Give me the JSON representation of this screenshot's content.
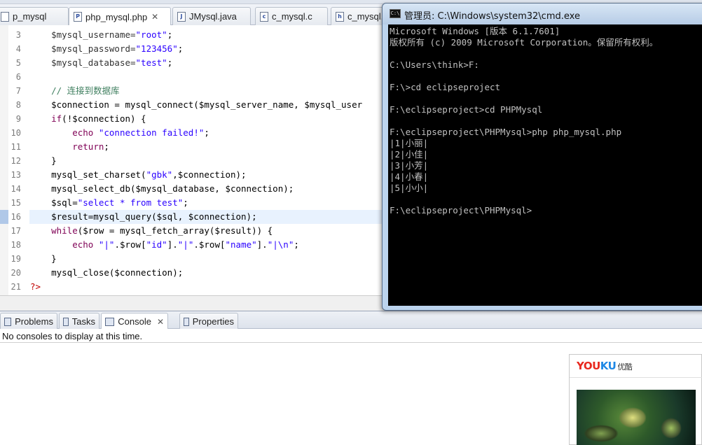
{
  "editor_tabs": [
    {
      "label": "p_mysql",
      "icon": "file-icon"
    },
    {
      "label": "php_mysql.php",
      "icon": "php-file-icon",
      "active": true,
      "closable": true
    },
    {
      "label": "JMysql.java",
      "icon": "java-file-icon"
    },
    {
      "label": "c_mysql.c",
      "icon": "c-file-icon"
    },
    {
      "label": "c_mysql.h",
      "icon": "h-file-icon"
    }
  ],
  "code": {
    "current_line": "16",
    "lines": [
      {
        "n": "3",
        "text": "    $mysql_username=\"root\";"
      },
      {
        "n": "4",
        "text": "    $mysql_password=\"123456\";"
      },
      {
        "n": "5",
        "text": "    $mysql_database=\"test\";"
      },
      {
        "n": "6",
        "text": ""
      },
      {
        "n": "7",
        "text": "    // 连接到数据库"
      },
      {
        "n": "8",
        "text": "    $connection = mysql_connect($mysql_server_name, $mysql_user"
      },
      {
        "n": "9",
        "text": "    if(!$connection) {"
      },
      {
        "n": "10",
        "text": "        echo \"connection failed!\";"
      },
      {
        "n": "11",
        "text": "        return;"
      },
      {
        "n": "12",
        "text": "    }"
      },
      {
        "n": "13",
        "text": "    mysql_set_charset(\"gbk\",$connection);"
      },
      {
        "n": "14",
        "text": "    mysql_select_db($mysql_database, $connection);"
      },
      {
        "n": "15",
        "text": "    $sql=\"select * from test\";"
      },
      {
        "n": "16",
        "text": "    $result=mysql_query($sql, $connection);"
      },
      {
        "n": "17",
        "text": "    while($row = mysql_fetch_array($result)) {"
      },
      {
        "n": "18",
        "text": "        echo \"|\".$row[\"id\"].\"|\".$row[\"name\"].\"|\\n\";"
      },
      {
        "n": "19",
        "text": "    }"
      },
      {
        "n": "20",
        "text": "    mysql_close($connection);"
      },
      {
        "n": "21",
        "text": "?>"
      }
    ]
  },
  "panel_tabs": [
    {
      "label": "Problems",
      "icon": "problems-icon"
    },
    {
      "label": "Tasks",
      "icon": "tasks-icon"
    },
    {
      "label": "Console",
      "icon": "console-icon",
      "active": true,
      "closable": true
    },
    {
      "label": "Properties",
      "icon": "properties-icon"
    }
  ],
  "console": {
    "message": "No consoles to display at this time."
  },
  "cmd": {
    "title": "管理员: C:\\Windows\\system32\\cmd.exe",
    "lines": [
      "Microsoft Windows [版本 6.1.7601]",
      "版权所有 (c) 2009 Microsoft Corporation。保留所有权利。",
      "",
      "C:\\Users\\think>F:",
      "",
      "F:\\>cd eclipseproject",
      "",
      "F:\\eclipseproject>cd PHPMysql",
      "",
      "F:\\eclipseproject\\PHPMysql>php php_mysql.php",
      "|1|小丽|",
      "|2|小佳|",
      "|3|小芳|",
      "|4|小春|",
      "|5|小小|",
      "",
      "F:\\eclipseproject\\PHPMysql>"
    ]
  },
  "youku": {
    "brand_you": "YOU",
    "brand_ku": "KU",
    "brand_cn": "优酷"
  }
}
